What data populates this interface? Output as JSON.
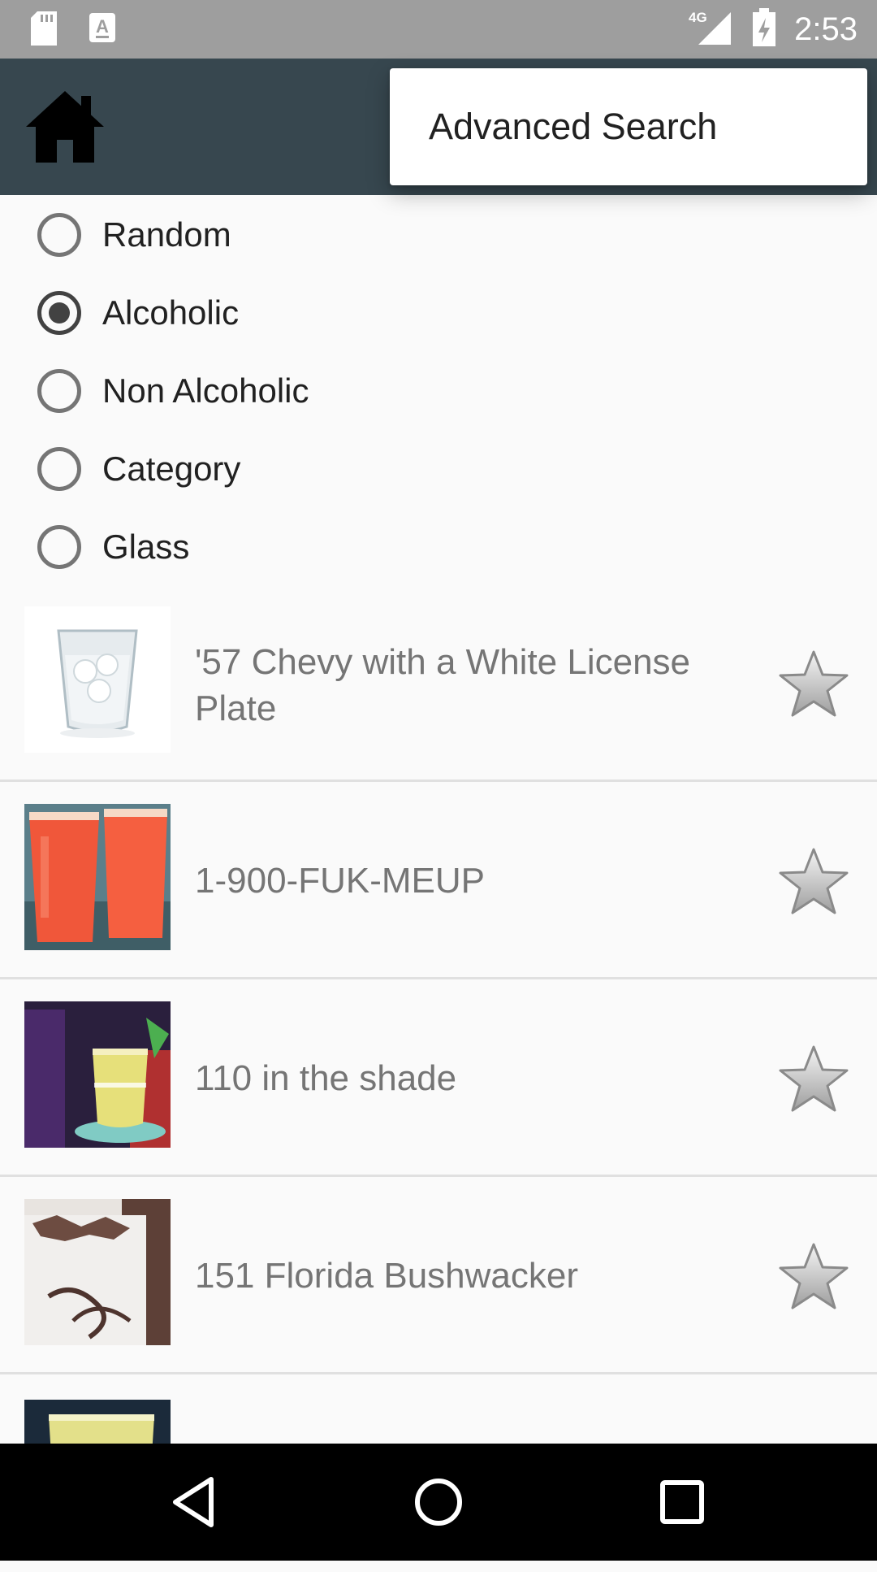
{
  "status_bar": {
    "time": "2:53",
    "network": "4G",
    "icons": [
      "sd-card-icon",
      "keyboard-a-icon",
      "signal-4g-icon",
      "battery-charging-icon"
    ]
  },
  "app_bar": {
    "home_icon": "home-icon",
    "background": "#37474f"
  },
  "overflow_menu": {
    "items": [
      {
        "label": "Advanced Search"
      }
    ]
  },
  "filter": {
    "options": [
      {
        "label": "Random",
        "checked": false
      },
      {
        "label": "Alcoholic",
        "checked": true
      },
      {
        "label": "Non Alcoholic",
        "checked": false
      },
      {
        "label": "Category",
        "checked": false
      },
      {
        "label": "Glass",
        "checked": false
      }
    ]
  },
  "drinks": [
    {
      "name": "'57 Chevy with a White License Plate",
      "favorite": false
    },
    {
      "name": "1-900-FUK-MEUP",
      "favorite": false
    },
    {
      "name": "110 in the shade",
      "favorite": false
    },
    {
      "name": "151 Florida Bushwacker",
      "favorite": false
    }
  ],
  "nav_bar": {
    "buttons": [
      "back-icon",
      "home-circle-icon",
      "recents-icon"
    ]
  }
}
